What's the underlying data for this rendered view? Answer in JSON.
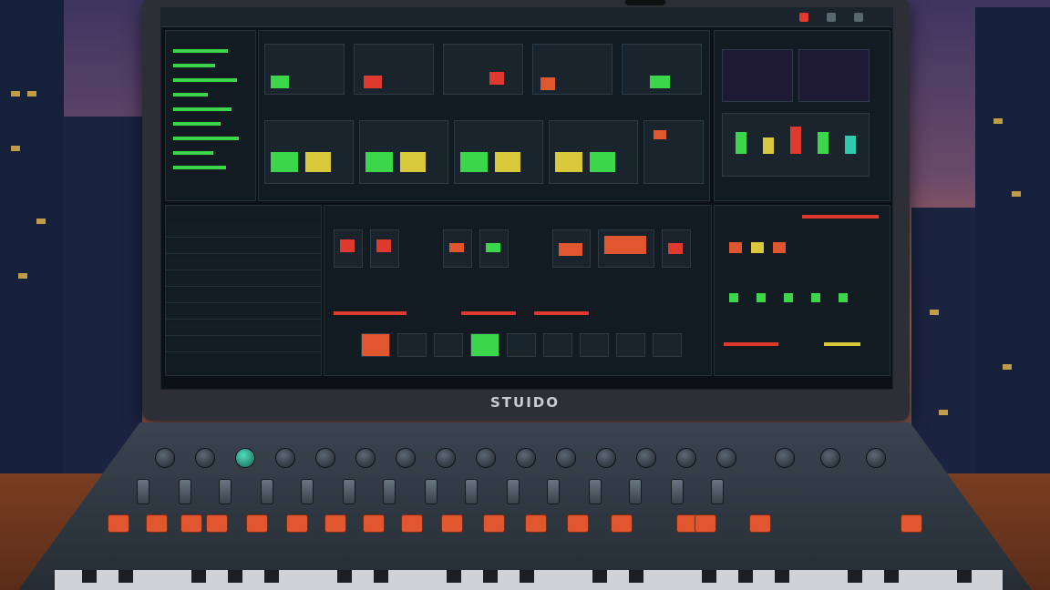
{
  "brand": {
    "label": "STUIDO"
  },
  "colors": {
    "screen_bg": "#0b1116",
    "led_green": "#3bd64a",
    "led_red": "#e03a2e",
    "led_yellow": "#d8c83a",
    "led_orange": "#e0562e",
    "accent_teal": "#2fc9b0",
    "button_orange": "#e0562e"
  }
}
